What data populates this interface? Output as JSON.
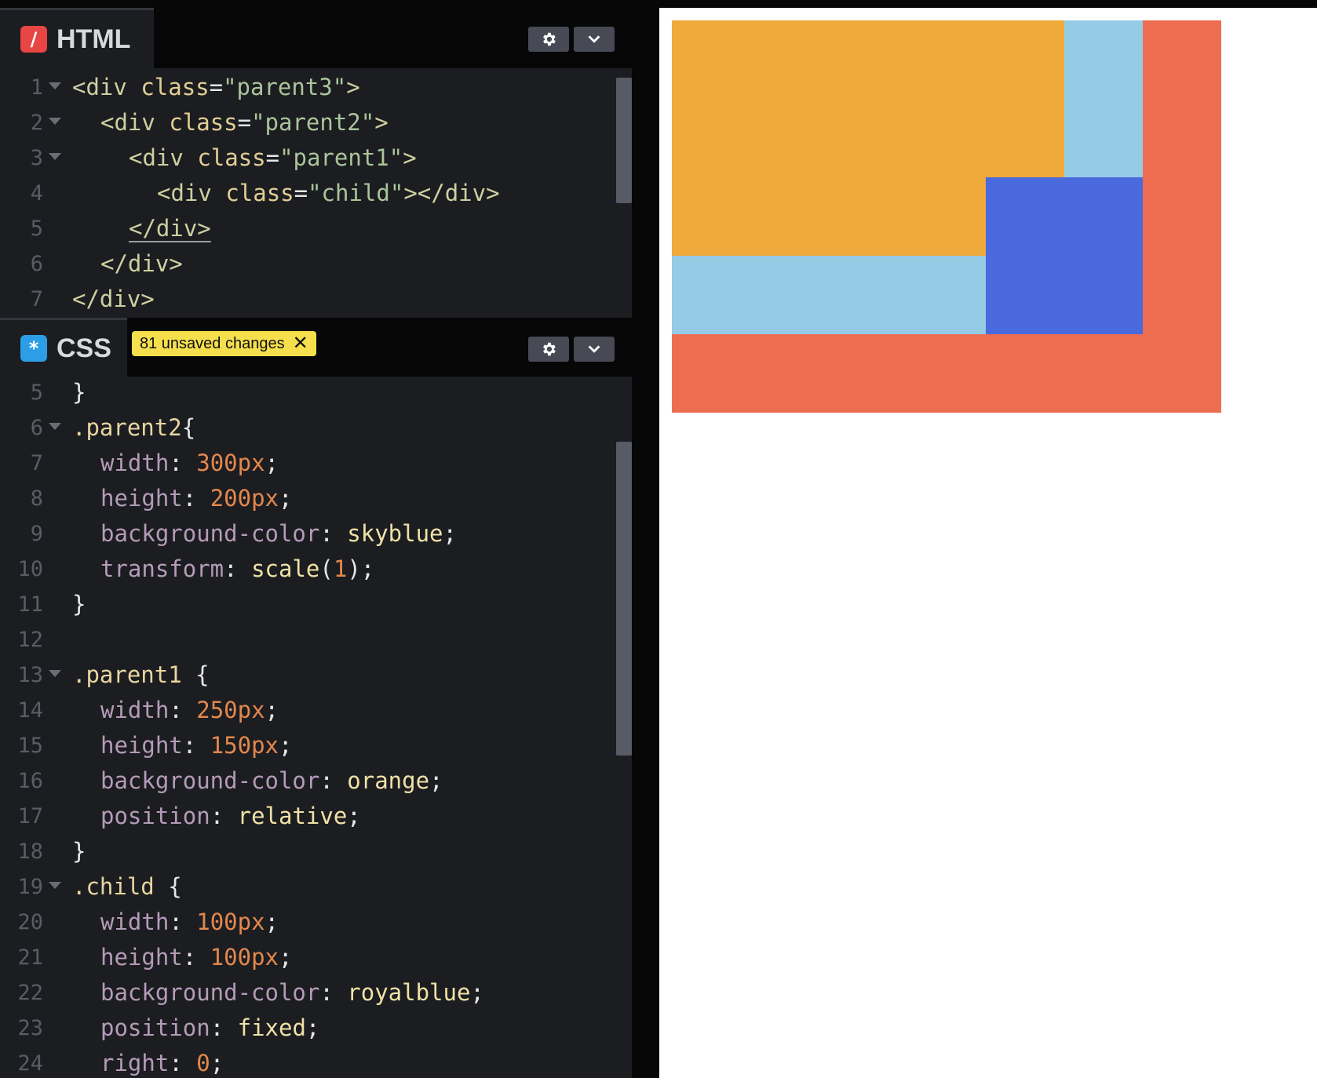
{
  "html_panel": {
    "title": "HTML",
    "icon_glyph": "/",
    "icon_color": "#e84545",
    "lines": [
      {
        "n": "1",
        "fold": true,
        "indent": 0,
        "tokens": [
          [
            "c-tag",
            "<div "
          ],
          [
            "c-attr",
            "class"
          ],
          [
            "c-punc",
            "="
          ],
          [
            "c-str",
            "\"parent3\""
          ],
          [
            "c-tag",
            ">"
          ]
        ]
      },
      {
        "n": "2",
        "fold": true,
        "indent": 1,
        "tokens": [
          [
            "c-tag",
            "<div "
          ],
          [
            "c-attr",
            "class"
          ],
          [
            "c-punc",
            "="
          ],
          [
            "c-str",
            "\"parent2\""
          ],
          [
            "c-tag",
            ">"
          ]
        ]
      },
      {
        "n": "3",
        "fold": true,
        "indent": 2,
        "tokens": [
          [
            "c-tag",
            "<div "
          ],
          [
            "c-attr",
            "class"
          ],
          [
            "c-punc",
            "="
          ],
          [
            "c-str",
            "\"parent1\""
          ],
          [
            "c-tag",
            ">"
          ]
        ]
      },
      {
        "n": "4",
        "fold": false,
        "indent": 3,
        "tokens": [
          [
            "c-tag",
            "<div "
          ],
          [
            "c-attr",
            "class"
          ],
          [
            "c-punc",
            "="
          ],
          [
            "c-str",
            "\"child\""
          ],
          [
            "c-tag",
            "></div>"
          ]
        ]
      },
      {
        "n": "5",
        "fold": false,
        "indent": 2,
        "tokens": [
          [
            "c-tag",
            "</div>"
          ]
        ]
      },
      {
        "n": "6",
        "fold": false,
        "indent": 1,
        "tokens": [
          [
            "c-tag",
            "</div>"
          ]
        ]
      },
      {
        "n": "7",
        "fold": false,
        "indent": 0,
        "tokens": [
          [
            "c-tag",
            "</div>"
          ]
        ]
      }
    ]
  },
  "css_panel": {
    "title": "CSS",
    "icon_glyph": "*",
    "icon_color": "#2b9ee6",
    "unsaved_badge": "81 unsaved changes",
    "lines": [
      {
        "n": "5",
        "fold": false,
        "indent": 0,
        "tokens": [
          [
            "c-punc",
            "}"
          ]
        ]
      },
      {
        "n": "6",
        "fold": true,
        "indent": 0,
        "tokens": [
          [
            "c-sel",
            ".parent2"
          ],
          [
            "c-punc",
            "{"
          ]
        ]
      },
      {
        "n": "7",
        "fold": false,
        "indent": 1,
        "tokens": [
          [
            "c-prop",
            "width"
          ],
          [
            "c-punc",
            ": "
          ],
          [
            "c-num",
            "300px"
          ],
          [
            "c-punc",
            ";"
          ]
        ]
      },
      {
        "n": "8",
        "fold": false,
        "indent": 1,
        "tokens": [
          [
            "c-prop",
            "height"
          ],
          [
            "c-punc",
            ": "
          ],
          [
            "c-num",
            "200px"
          ],
          [
            "c-punc",
            ";"
          ]
        ]
      },
      {
        "n": "9",
        "fold": false,
        "indent": 1,
        "tokens": [
          [
            "c-prop",
            "background-color"
          ],
          [
            "c-punc",
            ": "
          ],
          [
            "c-val",
            "skyblue"
          ],
          [
            "c-punc",
            ";"
          ]
        ]
      },
      {
        "n": "10",
        "fold": false,
        "indent": 1,
        "tokens": [
          [
            "c-prop",
            "transform"
          ],
          [
            "c-punc",
            ": "
          ],
          [
            "c-val",
            "scale"
          ],
          [
            "c-punc",
            "("
          ],
          [
            "c-num",
            "1"
          ],
          [
            "c-punc",
            ");"
          ]
        ]
      },
      {
        "n": "11",
        "fold": false,
        "indent": 0,
        "tokens": [
          [
            "c-punc",
            "}"
          ]
        ]
      },
      {
        "n": "12",
        "fold": false,
        "indent": 0,
        "tokens": []
      },
      {
        "n": "13",
        "fold": true,
        "indent": 0,
        "tokens": [
          [
            "c-sel",
            ".parent1"
          ],
          [
            "c-punc",
            " {"
          ]
        ]
      },
      {
        "n": "14",
        "fold": false,
        "indent": 1,
        "tokens": [
          [
            "c-prop",
            "width"
          ],
          [
            "c-punc",
            ": "
          ],
          [
            "c-num",
            "250px"
          ],
          [
            "c-punc",
            ";"
          ]
        ]
      },
      {
        "n": "15",
        "fold": false,
        "indent": 1,
        "tokens": [
          [
            "c-prop",
            "height"
          ],
          [
            "c-punc",
            ": "
          ],
          [
            "c-num",
            "150px"
          ],
          [
            "c-punc",
            ";"
          ]
        ]
      },
      {
        "n": "16",
        "fold": false,
        "indent": 1,
        "tokens": [
          [
            "c-prop",
            "background-color"
          ],
          [
            "c-punc",
            ": "
          ],
          [
            "c-val",
            "orange"
          ],
          [
            "c-punc",
            ";"
          ]
        ]
      },
      {
        "n": "17",
        "fold": false,
        "indent": 1,
        "tokens": [
          [
            "c-prop",
            "position"
          ],
          [
            "c-punc",
            ": "
          ],
          [
            "c-val",
            "relative"
          ],
          [
            "c-punc",
            ";"
          ]
        ]
      },
      {
        "n": "18",
        "fold": false,
        "indent": 0,
        "tokens": [
          [
            "c-punc",
            "}"
          ]
        ]
      },
      {
        "n": "19",
        "fold": true,
        "indent": 0,
        "tokens": [
          [
            "c-sel",
            ".child"
          ],
          [
            "c-punc",
            " {"
          ]
        ]
      },
      {
        "n": "20",
        "fold": false,
        "indent": 1,
        "tokens": [
          [
            "c-prop",
            "width"
          ],
          [
            "c-punc",
            ": "
          ],
          [
            "c-num",
            "100px"
          ],
          [
            "c-punc",
            ";"
          ]
        ]
      },
      {
        "n": "21",
        "fold": false,
        "indent": 1,
        "tokens": [
          [
            "c-prop",
            "height"
          ],
          [
            "c-punc",
            ": "
          ],
          [
            "c-num",
            "100px"
          ],
          [
            "c-punc",
            ";"
          ]
        ]
      },
      {
        "n": "22",
        "fold": false,
        "indent": 1,
        "tokens": [
          [
            "c-prop",
            "background-color"
          ],
          [
            "c-punc",
            ": "
          ],
          [
            "c-val",
            "royalblue"
          ],
          [
            "c-punc",
            ";"
          ]
        ]
      },
      {
        "n": "23",
        "fold": false,
        "indent": 1,
        "tokens": [
          [
            "c-prop",
            "position"
          ],
          [
            "c-punc",
            ": "
          ],
          [
            "c-val",
            "fixed"
          ],
          [
            "c-punc",
            ";"
          ]
        ]
      },
      {
        "n": "24",
        "fold": false,
        "indent": 1,
        "tokens": [
          [
            "c-prop",
            "right"
          ],
          [
            "c-punc",
            ": "
          ],
          [
            "c-num",
            "0"
          ],
          [
            "c-punc",
            ";"
          ]
        ]
      }
    ]
  },
  "toolbar_icons": {
    "settings": "gear-icon",
    "collapse": "chevron-down-icon"
  },
  "preview": {
    "colors": {
      "parent3": "#ec6d51",
      "parent2": "#96cbe6",
      "parent1": "#f0a93b",
      "child": "#4a69dc"
    }
  }
}
